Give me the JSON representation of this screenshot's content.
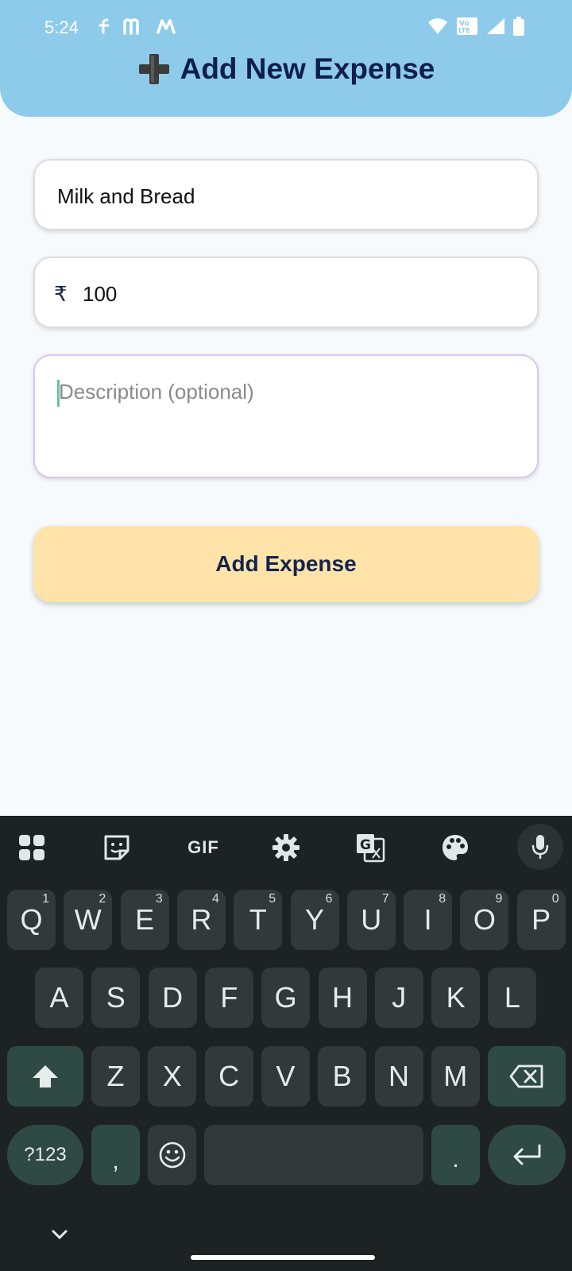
{
  "status_bar": {
    "time": "5:24",
    "app_icons": [
      "flipkart-icon",
      "myntra-icon",
      "meesho-icon"
    ],
    "right_icons": [
      "wifi-icon",
      "volte-icon",
      "signal-icon",
      "battery-icon"
    ],
    "volte_label": "Vo LTE"
  },
  "header": {
    "title": "Add New Expense",
    "icon": "plus-emoji-icon",
    "color": "#8ecbea"
  },
  "form": {
    "title_value": "Milk and Bread",
    "currency_symbol": "₹",
    "amount_value": "100",
    "description_placeholder": "Description (optional)",
    "submit_label": "Add Expense"
  },
  "keyboard": {
    "toolbar": [
      "apps-grid-icon",
      "sticker-icon",
      "gif-icon",
      "settings-icon",
      "translate-icon",
      "palette-icon",
      "mic-icon"
    ],
    "gif_label": "GIF",
    "row1": [
      {
        "k": "Q",
        "h": "1"
      },
      {
        "k": "W",
        "h": "2"
      },
      {
        "k": "E",
        "h": "3"
      },
      {
        "k": "R",
        "h": "4"
      },
      {
        "k": "T",
        "h": "5"
      },
      {
        "k": "Y",
        "h": "6"
      },
      {
        "k": "U",
        "h": "7"
      },
      {
        "k": "I",
        "h": "8"
      },
      {
        "k": "O",
        "h": "9"
      },
      {
        "k": "P",
        "h": "0"
      }
    ],
    "row2": [
      "A",
      "S",
      "D",
      "F",
      "G",
      "H",
      "J",
      "K",
      "L"
    ],
    "row3": [
      "Z",
      "X",
      "C",
      "V",
      "B",
      "N",
      "M"
    ],
    "symbols_label": "?123",
    "comma_label": ",",
    "period_label": ".",
    "accent": "#2f4a45"
  }
}
